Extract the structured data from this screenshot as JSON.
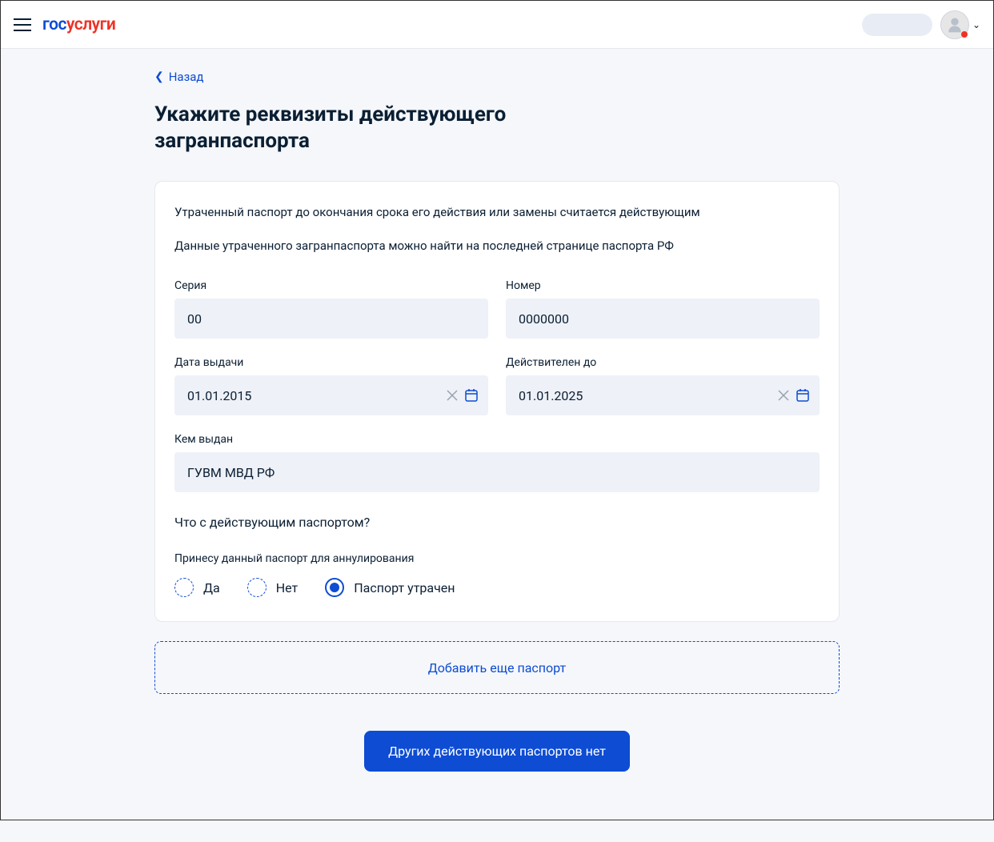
{
  "logo": {
    "part1": "гос",
    "part2": "услуги"
  },
  "back": "Назад",
  "title": "Укажите реквизиты действующего загранпаспорта",
  "info1": "Утраченный паспорт до окончания срока его действия или замены считается действующим",
  "info2": "Данные утраченного загранпаспорта можно найти на последней странице паспорта РФ",
  "fields": {
    "series": {
      "label": "Серия",
      "value": "00"
    },
    "number": {
      "label": "Номер",
      "value": "0000000"
    },
    "issueDate": {
      "label": "Дата выдачи",
      "value": "01.01.2015"
    },
    "validUntil": {
      "label": "Действителен до",
      "value": "01.01.2025"
    },
    "issuedBy": {
      "label": "Кем выдан",
      "value": "ГУВМ МВД РФ"
    }
  },
  "question": "Что с действующим паспортом?",
  "subLabel": "Принесу данный паспорт для аннулирования",
  "radios": {
    "yes": "Да",
    "no": "Нет",
    "lost": "Паспорт утрачен"
  },
  "addButton": "Добавить еще паспорт",
  "submitButton": "Других действующих паспортов нет"
}
